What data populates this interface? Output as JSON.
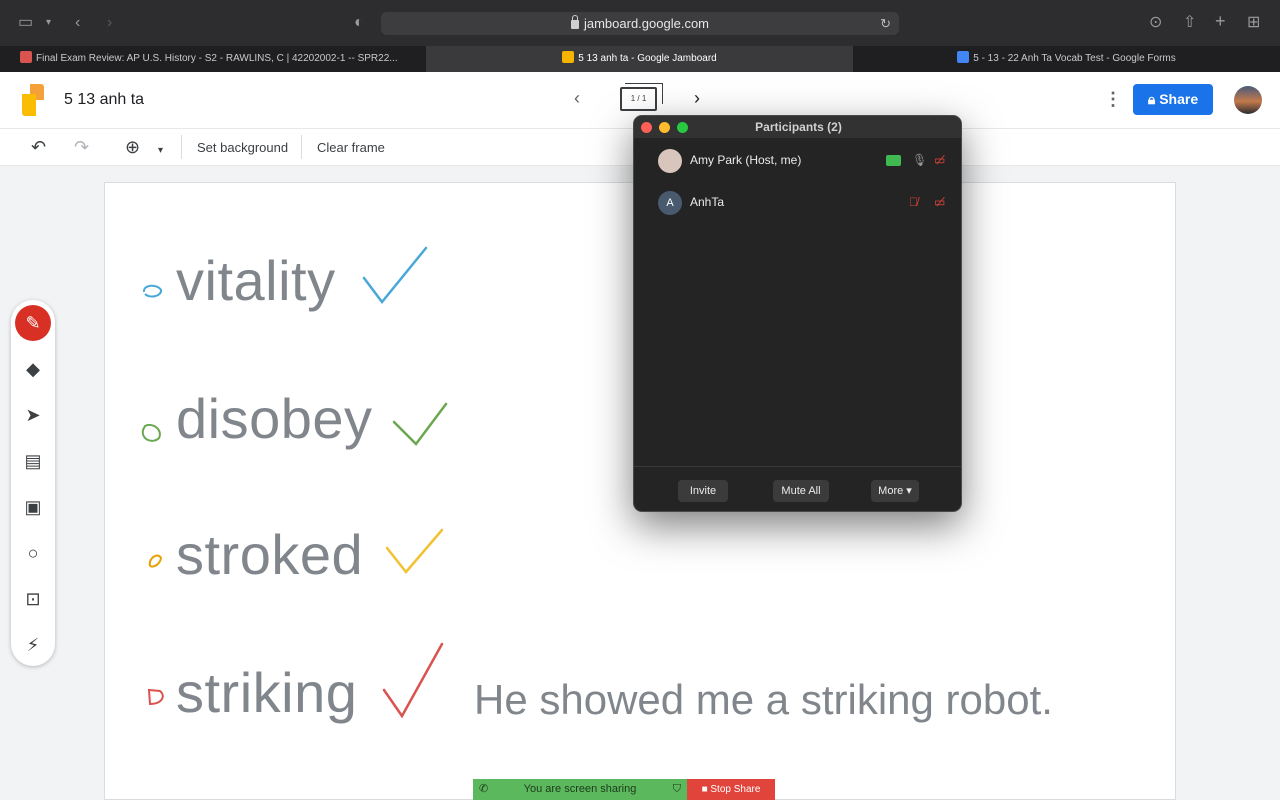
{
  "browser": {
    "url": "jamboard.google.com",
    "tabs": [
      {
        "title": "Final Exam Review: AP U.S. History - S2 - RAWLINS, C | 42202002-1 -- SPR22...",
        "active": false,
        "favicon_color": "#d9534f"
      },
      {
        "title": "5 13 anh ta - Google Jamboard",
        "active": true,
        "favicon_color": "#f4b400"
      },
      {
        "title": "5 - 13 - 22 Anh Ta Vocab Test - Google Forms",
        "active": false,
        "favicon_color": "#4285f4"
      }
    ]
  },
  "app": {
    "title": "5 13 anh ta",
    "frame_indicator": "1 / 1",
    "share_label": "Share",
    "toolbar": {
      "set_background": "Set background",
      "clear_frame": "Clear frame"
    }
  },
  "board": {
    "words": [
      {
        "text": "vitality",
        "check_color": "#4aa8d8",
        "dot_color": "#4aa8d8"
      },
      {
        "text": "disobey",
        "check_color": "#6aa84f",
        "dot_color": "#6aa84f"
      },
      {
        "text": "stroked",
        "check_color": "#f1c232",
        "dot_color": "#e6a100"
      },
      {
        "text": "striking",
        "check_color": "#d9534f",
        "dot_color": "#d9534f"
      }
    ],
    "sentence": "He showed me a striking robot."
  },
  "participants_window": {
    "title": "Participants (2)",
    "participants": [
      {
        "name": "Amy Park (Host, me)",
        "initial": ""
      },
      {
        "name": "AnhTa",
        "initial": "A"
      }
    ],
    "buttons": {
      "invite": "Invite",
      "mute_all": "Mute All",
      "more": "More"
    }
  },
  "screen_share": {
    "status": "You are screen sharing",
    "stop": "Stop Share"
  },
  "colors": {
    "share_button": "#1a73e8",
    "pen_tool": "#d93025",
    "word_text": "#80868b"
  }
}
